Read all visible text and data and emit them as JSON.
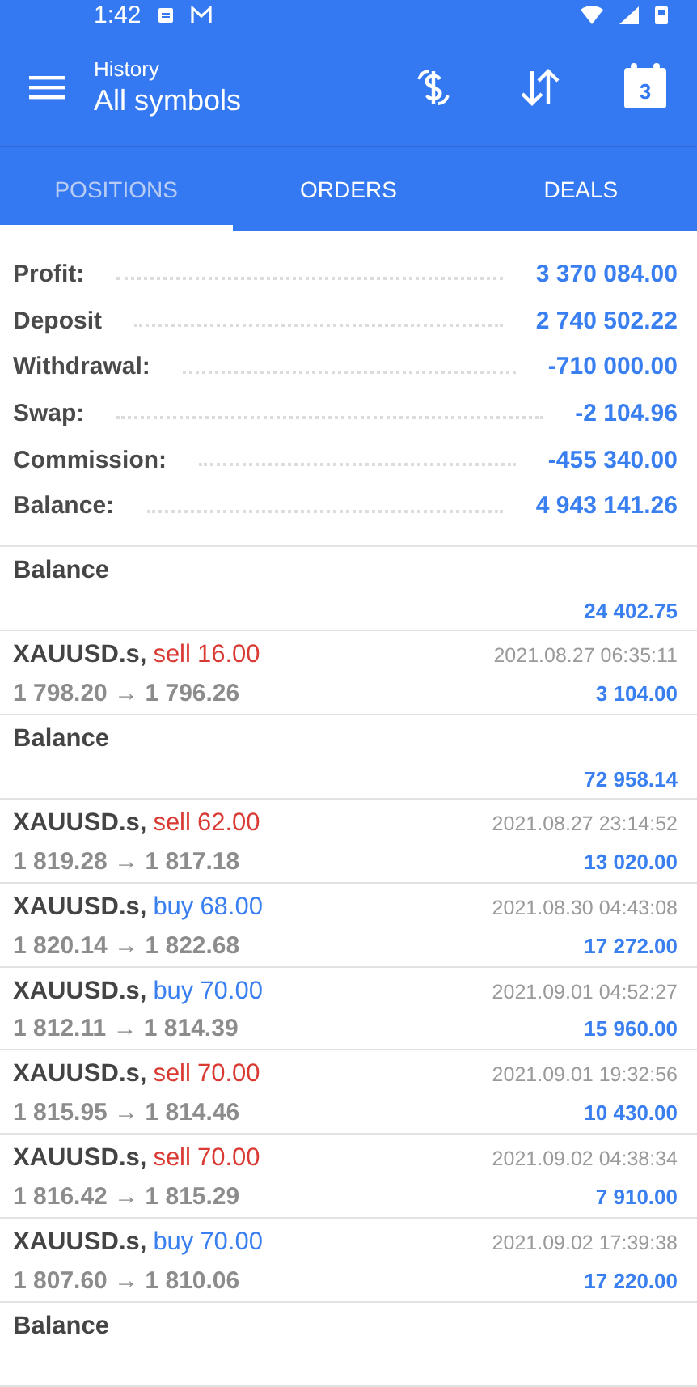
{
  "status_bar": {
    "time": "1:42"
  },
  "toolbar": {
    "subtitle": "History",
    "title": "All symbols",
    "calendar_day": "3"
  },
  "tabs": [
    {
      "label": "POSITIONS",
      "selected": true
    },
    {
      "label": "ORDERS",
      "selected": false
    },
    {
      "label": "DEALS",
      "selected": false
    }
  ],
  "summary": [
    {
      "label": "Profit:",
      "value": "3 370 084.00"
    },
    {
      "label": "Deposit",
      "value": "2 740 502.22"
    },
    {
      "label": "Withdrawal:",
      "value": "-710 000.00"
    },
    {
      "label": "Swap:",
      "value": "-2 104.96"
    },
    {
      "label": "Commission:",
      "value": "-455 340.00"
    },
    {
      "label": "Balance:",
      "value": "4 943 141.26"
    }
  ],
  "entries": [
    {
      "kind": "balance",
      "title": "Balance",
      "amount": "24 402.75"
    },
    {
      "kind": "deal",
      "symbol": "XAUUSD.s,",
      "side": "sell",
      "volume": "16.00",
      "prices": "1 798.20 → 1 796.26",
      "time": "2021.08.27 06:35:11",
      "amount": "3 104.00"
    },
    {
      "kind": "balance",
      "title": "Balance",
      "amount": "72 958.14"
    },
    {
      "kind": "deal",
      "symbol": "XAUUSD.s,",
      "side": "sell",
      "volume": "62.00",
      "prices": "1 819.28 → 1 817.18",
      "time": "2021.08.27 23:14:52",
      "amount": "13 020.00"
    },
    {
      "kind": "deal",
      "symbol": "XAUUSD.s,",
      "side": "buy",
      "volume": "68.00",
      "prices": "1 820.14 → 1 822.68",
      "time": "2021.08.30 04:43:08",
      "amount": "17 272.00"
    },
    {
      "kind": "deal",
      "symbol": "XAUUSD.s,",
      "side": "buy",
      "volume": "70.00",
      "prices": "1 812.11 → 1 814.39",
      "time": "2021.09.01 04:52:27",
      "amount": "15 960.00"
    },
    {
      "kind": "deal",
      "symbol": "XAUUSD.s,",
      "side": "sell",
      "volume": "70.00",
      "prices": "1 815.95 → 1 814.46",
      "time": "2021.09.01 19:32:56",
      "amount": "10 430.00"
    },
    {
      "kind": "deal",
      "symbol": "XAUUSD.s,",
      "side": "sell",
      "volume": "70.00",
      "prices": "1 816.42 → 1 815.29",
      "time": "2021.09.02 04:38:34",
      "amount": "7 910.00"
    },
    {
      "kind": "deal",
      "symbol": "XAUUSD.s,",
      "side": "buy",
      "volume": "70.00",
      "prices": "1 807.60 → 1 810.06",
      "time": "2021.09.02 17:39:38",
      "amount": "17 220.00"
    },
    {
      "kind": "balance",
      "title": "Balance"
    }
  ]
}
